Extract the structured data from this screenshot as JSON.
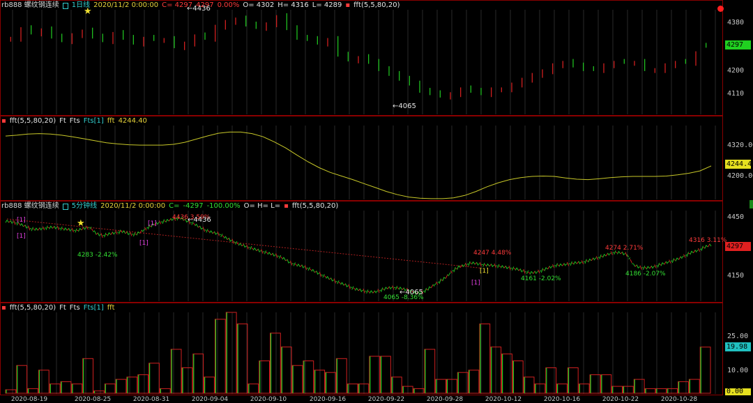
{
  "pane1": {
    "symbol": "rb888 螺纹钢连续",
    "period": "1日线",
    "date": "2020/11/2 0:00:00",
    "close": "C= 4297",
    "last": "4297",
    "change": "0.00%",
    "open": "O= 4302",
    "high": "H= 4316",
    "low": "L= 4289",
    "indicator": "fft(5,5,80,20)",
    "y_ticks": [
      "4380",
      "4200",
      "4110"
    ],
    "price_badge": "4297",
    "hi_label": "←4436",
    "lo_label": "←4065",
    "colors": {
      "up": "#d02020",
      "down": "#20c020",
      "badge_bg": "#20d020",
      "badge_fg": "#000000"
    }
  },
  "pane2": {
    "title": "fft(5,5,80,20)",
    "labels": [
      "Ft",
      "Fts",
      "Fts[1]"
    ],
    "value_label": "fft",
    "value": "4244.40",
    "y_ticks": [
      "4320.00",
      "4200.00"
    ],
    "badge": "4244.40",
    "colors": {
      "line": "#d4d42a",
      "badge_bg": "#e6e020",
      "badge_fg": "#000000"
    }
  },
  "pane3": {
    "symbol": "rb888 螺纹钢连续",
    "period": "5分钟线",
    "date": "2020/11/2 0:00:00",
    "close": "C=",
    "close_val": "-4297",
    "change": "-100.00%",
    "ohl": "O= H= L=",
    "indicator": "fft(5,5,80,20)",
    "y_ticks": [
      "4450",
      "4150"
    ],
    "price_badge": "4297",
    "annotations": {
      "peak1": "4436 3.59%",
      "hi": "←4436",
      "trough1": "4283 -2.42%",
      "lo": "←4065",
      "trough2": "4065 -8.36%",
      "peak2": "4247 4.48%",
      "trough3": "4161 -2.02%",
      "peak3": "4274 2.71%",
      "trough4": "4186 -2.07%",
      "peak4": "4316 3.11%",
      "mark_a": "[1]",
      "mark_b": "[1]",
      "mark_c": "[1]",
      "mark_d": "[1]",
      "mark_e": "[1]",
      "mark_f": "[1]"
    },
    "colors": {
      "badge_bg": "#e02020",
      "badge_fg": "#000000"
    }
  },
  "pane4": {
    "title": "fft(5,5,80,20)",
    "labels": [
      "Ft",
      "Fts",
      "Fts[1]"
    ],
    "value_label": "fft",
    "y_ticks": [
      "25.00",
      "10.00"
    ],
    "badge_value": "19.98",
    "badge_zero": "0.00",
    "colors": {
      "badge_bg": "#20c0c0",
      "zero_bg": "#e6e020"
    }
  },
  "x_axis": {
    "dates": [
      "2020-08-19",
      "2020-08-25",
      "2020-08-31",
      "2020-09-04",
      "2020-09-10",
      "2020-09-16",
      "2020-09-22",
      "2020-09-28",
      "2020-10-12",
      "2020-10-16",
      "2020-10-22",
      "2020-10-28"
    ]
  },
  "chart_data": [
    {
      "type": "candlestick",
      "title": "rb888 螺纹钢连续 1日线",
      "y_ticks": [
        4380,
        4290,
        4200,
        4110
      ],
      "ylim": [
        4020,
        4460
      ],
      "annotations": {
        "high": 4436,
        "low": 4065
      },
      "closes": [
        4330,
        4370,
        4352,
        4365,
        4335,
        4320,
        4345,
        4360,
        4335,
        4320,
        4350,
        4330,
        4310,
        4330,
        4325,
        4325,
        4295,
        4310,
        4340,
        4330,
        4380,
        4400,
        4410,
        4385,
        4375,
        4390,
        4420,
        4370,
        4330,
        4325,
        4310,
        4325,
        4260,
        4240,
        4250,
        4230,
        4200,
        4180,
        4160,
        4140,
        4110,
        4100,
        4090,
        4100,
        4120,
        4110,
        4100,
        4120,
        4120,
        4140,
        4160,
        4180,
        4195,
        4220,
        4230,
        4215,
        4200,
        4200,
        4220,
        4230,
        4230,
        4230,
        4200,
        4200,
        4220,
        4230,
        4230,
        4270,
        4297
      ],
      "up_flags": [
        1,
        1,
        0,
        1,
        0,
        0,
        1,
        1,
        0,
        0,
        1,
        0,
        0,
        1,
        0,
        1,
        0,
        1,
        1,
        0,
        1,
        1,
        1,
        0,
        0,
        1,
        1,
        0,
        0,
        0,
        0,
        1,
        0,
        0,
        1,
        0,
        0,
        0,
        0,
        0,
        0,
        0,
        0,
        1,
        1,
        0,
        0,
        1,
        1,
        1,
        1,
        1,
        1,
        1,
        1,
        0,
        0,
        0,
        1,
        1,
        0,
        1,
        0,
        1,
        1,
        1,
        0,
        1,
        0
      ]
    },
    {
      "type": "line",
      "title": "fft(5,5,80,20)",
      "ylim": [
        4160,
        4350
      ],
      "y_ticks": [
        4320,
        4200
      ],
      "values": [
        4320,
        4322,
        4325,
        4326,
        4325,
        4322,
        4318,
        4313,
        4308,
        4303,
        4300,
        4298,
        4297,
        4297,
        4297,
        4299,
        4304,
        4312,
        4320,
        4327,
        4330,
        4330,
        4326,
        4318,
        4305,
        4290,
        4272,
        4255,
        4240,
        4228,
        4219,
        4210,
        4200,
        4190,
        4180,
        4172,
        4166,
        4163,
        4162,
        4162,
        4164,
        4170,
        4180,
        4192,
        4202,
        4210,
        4215,
        4218,
        4219,
        4218,
        4214,
        4211,
        4210,
        4212,
        4215,
        4217,
        4218,
        4218,
        4218,
        4219,
        4222,
        4226,
        4232,
        4244.4
      ]
    },
    {
      "type": "line",
      "title": "rb888 螺纹钢连续 5分钟线",
      "ylim": [
        4040,
        4480
      ],
      "y_ticks": [
        4450,
        4300,
        4150
      ],
      "values": [
        4410,
        4405,
        4398,
        4385,
        4372,
        4370,
        4376,
        4380,
        4378,
        4372,
        4368,
        4364,
        4374,
        4380,
        4350,
        4340,
        4348,
        4354,
        4360,
        4350,
        4345,
        4360,
        4380,
        4395,
        4405,
        4412,
        4420,
        4425,
        4410,
        4398,
        4380,
        4365,
        4355,
        4348,
        4330,
        4315,
        4300,
        4290,
        4280,
        4270,
        4262,
        4252,
        4244,
        4230,
        4210,
        4200,
        4192,
        4180,
        4165,
        4150,
        4135,
        4122,
        4110,
        4098,
        4085,
        4078,
        4072,
        4070,
        4080,
        4090,
        4092,
        4088,
        4080,
        4070,
        4065,
        4080,
        4100,
        4120,
        4140,
        4170,
        4190,
        4200,
        4210,
        4205,
        4200,
        4198,
        4195,
        4190,
        4185,
        4180,
        4170,
        4162,
        4165,
        4175,
        4188,
        4198,
        4200,
        4205,
        4210,
        4212,
        4220,
        4230,
        4240,
        4250,
        4260,
        4258,
        4250,
        4200,
        4188,
        4186,
        4190,
        4200,
        4210,
        4220,
        4230,
        4245,
        4260,
        4270,
        4285,
        4297
      ]
    },
    {
      "type": "bar",
      "title": "fft(5,5,80,20)",
      "ylim": [
        0,
        35
      ],
      "y_ticks": [
        25,
        10,
        0
      ],
      "values": [
        1.5,
        12,
        2,
        10,
        4,
        5,
        4,
        15,
        1,
        4,
        6,
        7,
        8,
        13,
        2,
        19,
        11,
        17,
        7,
        32,
        35,
        30,
        4,
        14,
        26,
        20,
        12,
        14,
        10,
        9,
        15,
        4,
        4,
        16,
        16,
        7,
        3,
        2,
        19,
        6,
        6,
        9,
        10,
        30,
        20,
        17,
        14,
        7,
        4,
        11,
        4,
        11,
        4,
        8,
        8,
        3,
        3,
        6,
        2,
        2,
        2,
        5,
        6,
        19.98
      ]
    }
  ]
}
